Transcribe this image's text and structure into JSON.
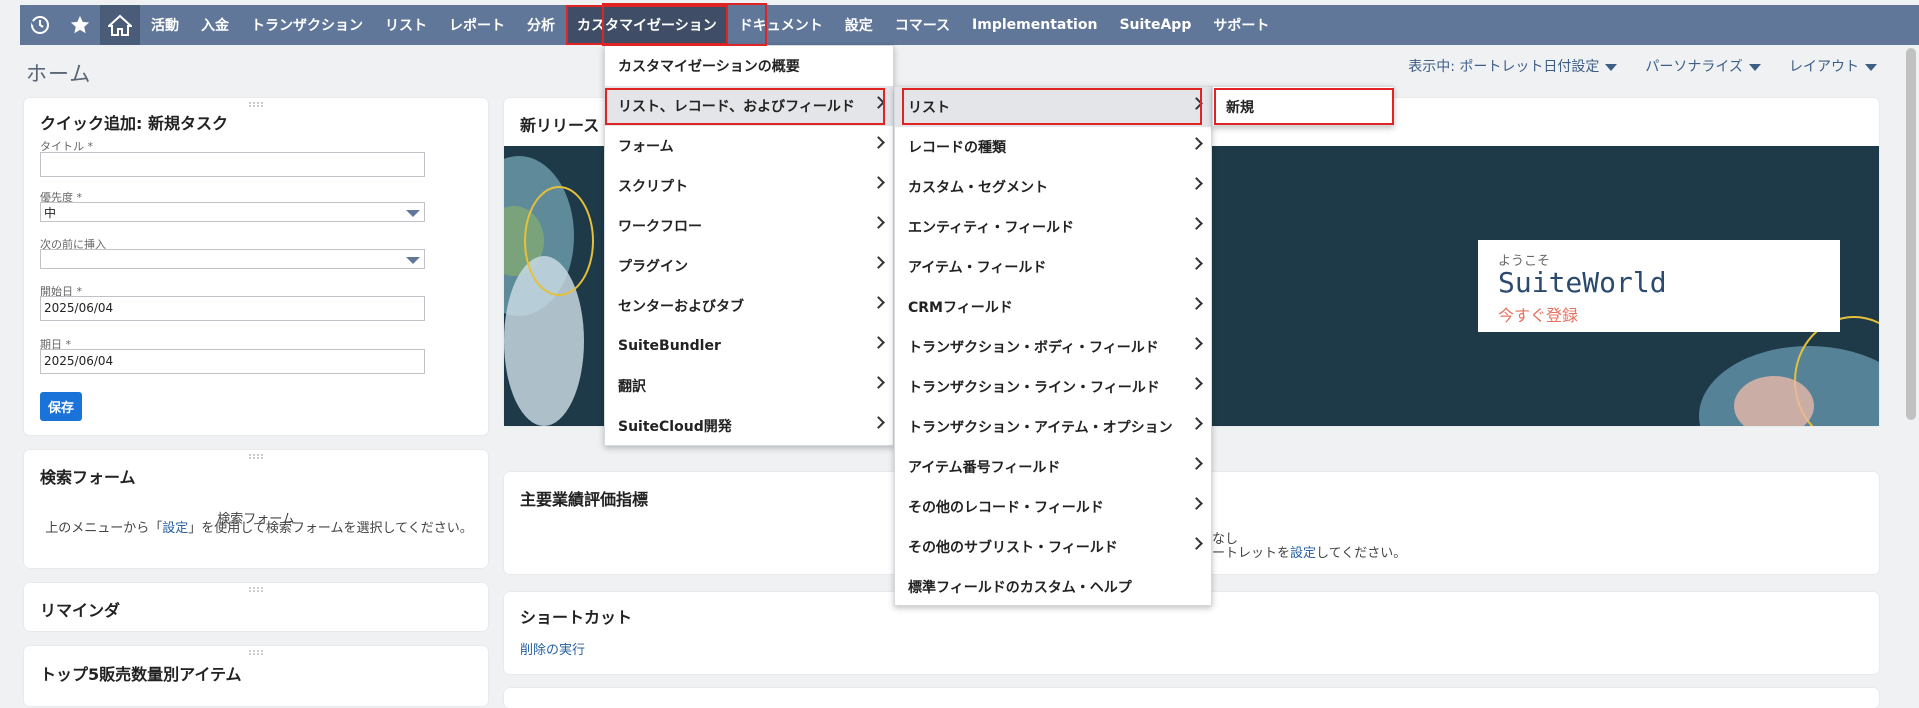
{
  "nav": {
    "items": [
      "活動",
      "入金",
      "トランザクション",
      "リスト",
      "レポート",
      "分析",
      "カスタマイゼーション",
      "ドキュメント",
      "設定",
      "コマース",
      "Implementation",
      "SuiteApp",
      "サポート"
    ]
  },
  "page": {
    "title": "ホーム",
    "view_label": "表示中: ポートレット日付設定",
    "personalize": "パーソナライズ",
    "layout": "レイアウト"
  },
  "quick_add": {
    "title": "クイック追加: 新規タスク",
    "title_label": "タイトル *",
    "title_value": "",
    "priority_label": "優先度 *",
    "priority_value": "中",
    "insert_label": "次の前に挿入",
    "insert_value": "",
    "start_label": "開始日 *",
    "start_value": "2025/06/04",
    "due_label": "期日 *",
    "due_value": "2025/06/04",
    "save": "保存"
  },
  "search_form": {
    "title": "検索フォーム",
    "sub": "検索フォーム",
    "msg_pre": "上のメニューから「",
    "msg_link": "設定",
    "msg_post": "」を使用して検索フォームを選択してください。"
  },
  "reminders": {
    "title": "リマインダ"
  },
  "top5": {
    "title": "トップ5販売数量別アイテム"
  },
  "release": {
    "title": "新リリース"
  },
  "banner": {
    "welcome": "ようこそ",
    "name": "SuiteWorld",
    "cta": "今すぐ登録"
  },
  "kpi": {
    "title": "主要業績評価指標",
    "none": "なし",
    "msg_pre": "ートレットを",
    "msg_link": "設定",
    "msg_post": "してください。"
  },
  "shortcuts": {
    "title": "ショートカット",
    "link": "削除の実行"
  },
  "menu1": {
    "items": [
      "カスタマイゼーションの概要",
      "リスト、レコード、およびフィールド",
      "フォーム",
      "スクリプト",
      "ワークフロー",
      "プラグイン",
      "センターおよびタブ",
      "SuiteBundler",
      "翻訳",
      "SuiteCloud開発"
    ]
  },
  "menu2": {
    "items": [
      "リスト",
      "レコードの種類",
      "カスタム・セグメント",
      "エンティティ・フィールド",
      "アイテム・フィールド",
      "CRMフィールド",
      "トランザクション・ボディ・フィールド",
      "トランザクション・ライン・フィールド",
      "トランザクション・アイテム・オプション",
      "アイテム番号フィールド",
      "その他のレコード・フィールド",
      "その他のサブリスト・フィールド",
      "標準フィールドのカスタム・ヘルプ"
    ]
  },
  "menu3": {
    "items": [
      "新規"
    ]
  },
  "colors": {
    "nav": "#607799",
    "accent": "#e02424",
    "button": "#1a73d9",
    "link": "#2660a4"
  }
}
